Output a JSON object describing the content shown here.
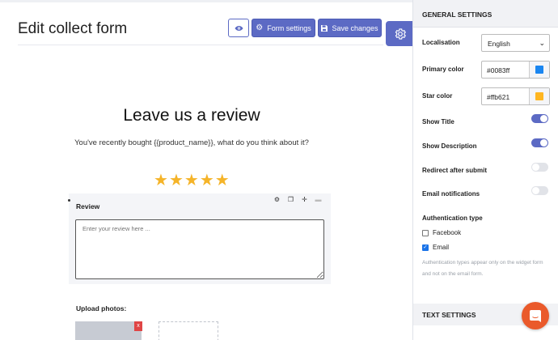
{
  "header": {
    "title": "Edit collect form",
    "preview_icon": "eye-icon",
    "form_settings_label": "Form settings",
    "form_settings_icon": "gear-icon",
    "save_label": "Save changes",
    "save_icon": "floppy-disk-icon",
    "panel_toggle_icon": "gear-icon"
  },
  "form": {
    "title": "Leave us a review",
    "description": "You've recently bought {{product_name}}, what do you think about it?",
    "stars": [
      "★",
      "★",
      "★",
      "★",
      "★"
    ],
    "star_color": "#f5b429",
    "review_block": {
      "label": "Review",
      "placeholder": "Enter your review here ...",
      "tools": [
        "settings-icon",
        "duplicate-icon",
        "move-icon",
        "delete-icon"
      ]
    },
    "upload": {
      "label": "Upload photos:",
      "remove_label": "x"
    }
  },
  "settings": {
    "general_title": "GENERAL SETTINGS",
    "localisation": {
      "label": "Localisation",
      "value": "English"
    },
    "primary_color": {
      "label": "Primary color",
      "value": "#0083ff",
      "swatch": "#1a86f0"
    },
    "star_color": {
      "label": "Star color",
      "value": "#ffb621",
      "swatch": "#ffb621"
    },
    "toggles": [
      {
        "label": "Show Title",
        "on": true
      },
      {
        "label": "Show Description",
        "on": true
      },
      {
        "label": "Redirect after submit",
        "on": false
      },
      {
        "label": "Email notifications",
        "on": false
      }
    ],
    "auth": {
      "title": "Authentication type",
      "options": [
        {
          "label": "Facebook",
          "checked": false
        },
        {
          "label": "Email",
          "checked": true
        }
      ],
      "note": "Authentication types appear only on the widget form and not on the email form."
    },
    "text_title": "TEXT SETTINGS"
  },
  "chat": {
    "icon": "chat-bubble-icon"
  },
  "colors": {
    "accent": "#5c6ac4",
    "chat": "#ea5a2b",
    "checkbox": "#1a73e8"
  }
}
